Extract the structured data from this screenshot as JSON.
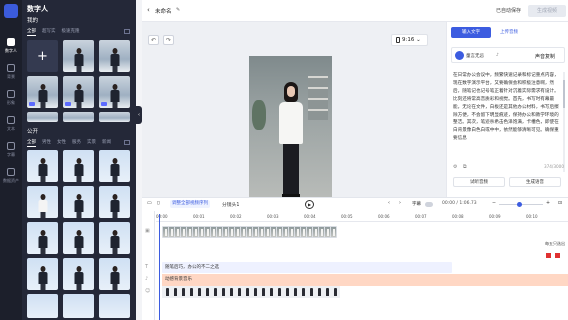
{
  "rail": {
    "items": [
      {
        "label": "数字人",
        "icon": "person-icon",
        "active": true
      },
      {
        "label": "背景",
        "icon": "image-icon",
        "active": false
      },
      {
        "label": "形象",
        "icon": "figure-icon",
        "active": false
      },
      {
        "label": "文本",
        "icon": "text-icon",
        "active": false
      },
      {
        "label": "字幕",
        "icon": "subtitle-icon",
        "active": false
      },
      {
        "label": "数据资产",
        "icon": "asset-icon",
        "active": false
      }
    ]
  },
  "library": {
    "title": "数字人",
    "mine_heading": "我的",
    "mine_tabs": [
      "全部",
      "超写实",
      "极速克隆"
    ],
    "add_symbol": "+",
    "public_heading": "公开",
    "public_tabs": [
      "全部",
      "男性",
      "女性",
      "服务",
      "实景",
      "新闻"
    ]
  },
  "topbar": {
    "back_symbol": "‹",
    "title": "未命名",
    "edit_symbol": "✎",
    "save_status": "已自动保存",
    "generate_button": "生成视频"
  },
  "canvas": {
    "undo": "↶",
    "redo": "↷",
    "ratio": "9:16",
    "ratio_caret": "⌄"
  },
  "right_panel": {
    "tab_input": "输入文字",
    "tab_upload": "上传音频",
    "voice_name": "童言无忌",
    "voice_tag": "♪",
    "voice_button": "声音复制",
    "script": "在日常办公会议中，频繁快速记录和标记重点内容，现在数字演示平台，又要确保会和积极注意啊，然后，随笔记也记号笔正着针对沉着实际需求有设计。\n比刻还将常高音质彩和视觉。首先，书写时有幕最能，无论在文件，白板还是其他办公材料，书写后擦除方便，不会留下明显痕迹，保持办公和教学环境的整洁。其次，笔迹杀希击色泽饱满，卡槽色，即使在白背景像白色白或中中，依然能够清晰可见。确保重要信息",
    "char_count": "374/3000",
    "audition_button": "试听音频",
    "generate_button": "生成语音"
  },
  "timeline": {
    "split_label": "调整全部视频序列",
    "shot_label": "分镜头1",
    "caption_label": "字幕",
    "timecode": "00:00 / 1:06.73",
    "ruler_ticks": [
      "00:01",
      "00:02",
      "00:03",
      "00:04",
      "00:05",
      "00:06",
      "00:07",
      "00:08",
      "00:09",
      "00:10",
      "00:11"
    ],
    "subtitle_clip": "随笔后巧，办公的不二之选",
    "music_clip": "动感背景音乐",
    "red_tag_label": "每五只选出"
  },
  "colors": {
    "accent": "#3c5ce0",
    "rail_bg": "#1c1f2b",
    "library_bg": "#242838",
    "music_track": "#ffd7c4"
  }
}
